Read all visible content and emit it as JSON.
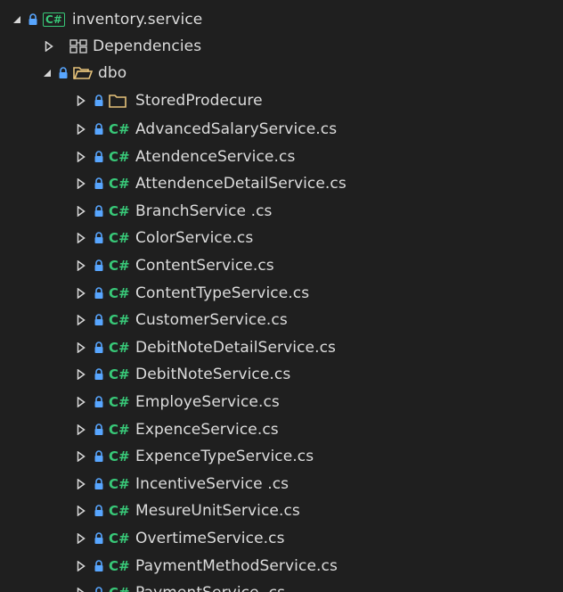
{
  "colors": {
    "accent": "#38c878",
    "lock": "#58a6ff",
    "folder": "#e6c27a"
  },
  "root": {
    "label": "inventory.service",
    "icon": "csharp-project-icon",
    "state": "expanded"
  },
  "dependencies": {
    "label": "Dependencies",
    "icon": "dependencies-icon",
    "state": "collapsed"
  },
  "dbo": {
    "label": "dbo",
    "icon": "folder-open-icon",
    "state": "expanded"
  },
  "stored_procedure_folder": {
    "label": "StoredProdecure",
    "icon": "folder-icon",
    "state": "collapsed"
  },
  "files": [
    {
      "label": "AdvancedSalaryService.cs"
    },
    {
      "label": "AtendenceService.cs"
    },
    {
      "label": "AttendenceDetailService.cs"
    },
    {
      "label": "BranchService .cs"
    },
    {
      "label": "ColorService.cs"
    },
    {
      "label": "ContentService.cs"
    },
    {
      "label": "ContentTypeService.cs"
    },
    {
      "label": "CustomerService.cs"
    },
    {
      "label": "DebitNoteDetailService.cs"
    },
    {
      "label": "DebitNoteService.cs"
    },
    {
      "label": "EmployeService.cs"
    },
    {
      "label": "ExpenceService.cs"
    },
    {
      "label": "ExpenceTypeService.cs"
    },
    {
      "label": "IncentiveService .cs"
    },
    {
      "label": "MesureUnitService.cs"
    },
    {
      "label": "OvertimeService.cs"
    },
    {
      "label": "PaymentMethodService.cs"
    },
    {
      "label": "PaymentService .cs"
    }
  ],
  "csharp_glyph": "C#"
}
